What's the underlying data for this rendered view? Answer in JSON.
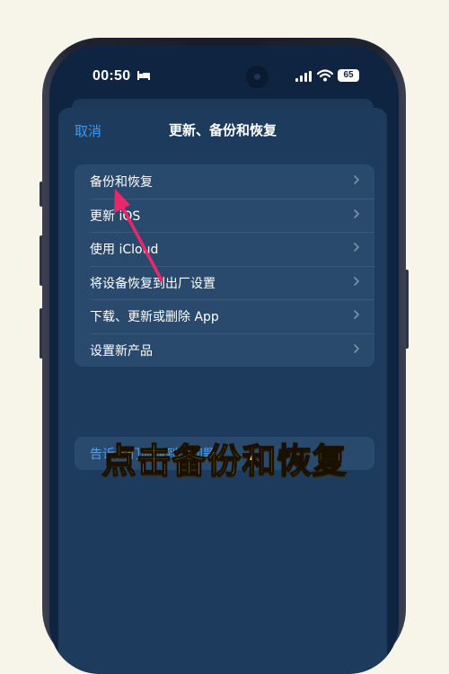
{
  "status_bar": {
    "time": "00:50",
    "battery": "65",
    "sleep_icon": "bed-icon",
    "signal_icon": "cellular-signal-icon",
    "wifi_icon": "wifi-icon"
  },
  "nav": {
    "cancel": "取消",
    "title": "更新、备份和恢复"
  },
  "menu": {
    "items": [
      {
        "label": "备份和恢复"
      },
      {
        "label": "更新 iOS"
      },
      {
        "label": "使用 iCloud"
      },
      {
        "label": "将设备恢复到出厂设置"
      },
      {
        "label": "下载、更新或删除 App"
      },
      {
        "label": "设置新产品"
      }
    ]
  },
  "report": {
    "label": "告诉我们你遇到的问题"
  },
  "caption": "点击备份和恢复",
  "colors": {
    "accent": "#3d9bf0",
    "caption": "#ffe12b",
    "arrow": "#e8286a"
  }
}
